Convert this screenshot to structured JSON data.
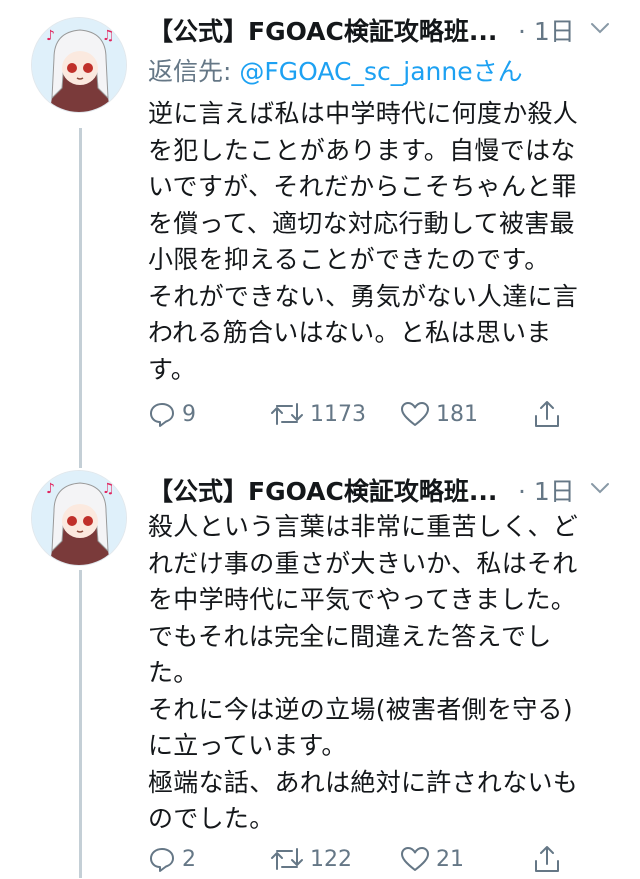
{
  "tweets": [
    {
      "author": "【公式】FGOAC検証攻略班...",
      "time": "· 1日",
      "reply_prefix": "返信先: ",
      "reply_handle": "@FGOAC_sc_janne",
      "reply_suffix": "さん",
      "lines": [
        "逆に言えば私は中学時代に何度か殺人",
        "を犯したことがあります。自慢ではな",
        "いですが、それだからこそちゃんと罪",
        "を償って、適切な対応行動して被害最",
        "小限を抑えることができたのです。",
        "それができない、勇気がない人達に言",
        "われる筋合いはない。と私は思いま",
        "す。"
      ],
      "replies": "9",
      "retweets": "1173",
      "likes": "181"
    },
    {
      "author": "【公式】FGOAC検証攻略班...",
      "time": "· 1日",
      "lines": [
        "殺人という言葉は非常に重苦しく、ど",
        "れだけ事の重さが大きいか、私はそれ",
        "を中学時代に平気でやってきました。",
        "でもそれは完全に間違えた答えでし",
        "た。",
        "それに今は逆の立場(被害者側を守る)",
        "に立っています。",
        "極端な話、あれは絶対に許されないも",
        "のでした。"
      ],
      "replies": "2",
      "retweets": "122",
      "likes": "21"
    }
  ],
  "icons": [
    "avatar",
    "chevron-down-icon",
    "reply-icon",
    "retweet-icon",
    "like-icon",
    "share-icon"
  ],
  "colors": {
    "link": "#1da1f2",
    "muted": "#657786",
    "thread_line": "#c4cfd6"
  }
}
